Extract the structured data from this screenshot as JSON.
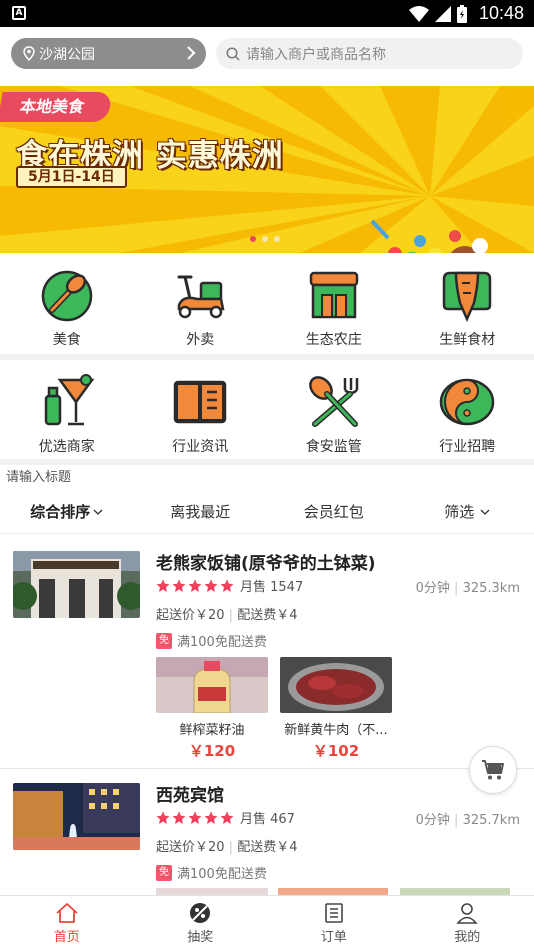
{
  "status_bar": {
    "time": "10:48"
  },
  "header": {
    "location": "沙湖公园",
    "search_placeholder": "请输入商户或商品名称"
  },
  "banner": {
    "tag": "本地美食",
    "title": "食在株洲 实惠株洲",
    "date": "5月1日-14日",
    "page_count": 3,
    "active_page": 0
  },
  "categories_row1": [
    {
      "label": "美食",
      "icon": "food-icon"
    },
    {
      "label": "外卖",
      "icon": "scooter-icon"
    },
    {
      "label": "生态农庄",
      "icon": "farm-store-icon"
    },
    {
      "label": "生鲜食材",
      "icon": "carrot-icon"
    }
  ],
  "categories_row2": [
    {
      "label": "优选商家",
      "icon": "cocktail-icon"
    },
    {
      "label": "行业资讯",
      "icon": "book-icon"
    },
    {
      "label": "食安监管",
      "icon": "spoon-fork-icon"
    },
    {
      "label": "行业招聘",
      "icon": "yin-yang-icon"
    }
  ],
  "section_title": "请输入标题",
  "sort_tabs": [
    {
      "label": "综合排序",
      "active": true
    },
    {
      "label": "离我最近",
      "active": false
    },
    {
      "label": "会员红包",
      "active": false
    },
    {
      "label": "筛选",
      "active": false
    }
  ],
  "shops": [
    {
      "name": "老熊家饭铺(原爷爷的土钵菜)",
      "rating_stars": 5,
      "monthly_sales": "月售 1547",
      "time": "0分钟",
      "distance": "325.3km",
      "min_order": "起送价￥20",
      "delivery_fee": "配送费￥4",
      "promo_badge": "免",
      "promo": "满100免配送费",
      "products": [
        {
          "name": "鲜榨菜籽油",
          "price": "￥120"
        },
        {
          "name": "新鲜黄牛肉（不...",
          "price": "￥102"
        }
      ]
    },
    {
      "name": "西苑宾馆",
      "rating_stars": 5,
      "monthly_sales": "月售 467",
      "time": "0分钟",
      "distance": "325.7km",
      "min_order": "起送价￥20",
      "delivery_fee": "配送费￥4",
      "promo_badge": "免",
      "promo": "满100免配送费"
    }
  ],
  "bottom_nav": [
    {
      "label": "首页",
      "icon": "home-icon",
      "active": true
    },
    {
      "label": "抽奖",
      "icon": "lottery-icon",
      "active": false
    },
    {
      "label": "订单",
      "icon": "order-list-icon",
      "active": false
    },
    {
      "label": "我的",
      "icon": "user-icon",
      "active": false
    }
  ],
  "colors": {
    "accent": "#e8453c",
    "icon_green": "#3cb85a",
    "icon_orange": "#f2893a",
    "banner_yellow": "#f7c800"
  }
}
